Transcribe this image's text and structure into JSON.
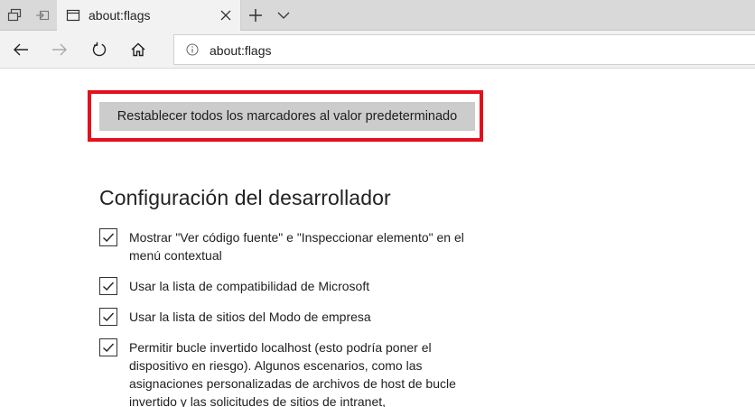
{
  "browser": {
    "tab": {
      "title": "about:flags"
    },
    "address_bar": {
      "url": "about:flags"
    },
    "icons": {
      "tab_list": "tabs-icon",
      "set_aside": "set-aside-tabs-icon",
      "favicon": "page-icon",
      "close": "close-icon",
      "new_tab": "plus-icon",
      "tab_menu": "chevron-down-icon",
      "back": "back-arrow-icon",
      "forward": "forward-arrow-icon",
      "refresh": "refresh-icon",
      "home": "home-icon",
      "info": "info-icon"
    }
  },
  "page": {
    "reset_button_label": "Restablecer todos los marcadores al valor predeterminado",
    "highlight_color": "#e3101e",
    "section_title": "Configuración del desarrollador",
    "options": [
      {
        "label": "Mostrar \"Ver código fuente\" e \"Inspeccionar elemento\" en el menú contextual",
        "checked": true
      },
      {
        "label": "Usar la lista de compatibilidad de Microsoft",
        "checked": true
      },
      {
        "label": "Usar la lista de sitios del Modo de empresa",
        "checked": true
      },
      {
        "label": "Permitir bucle invertido localhost (esto podría poner el dispositivo en riesgo). Algunos escenarios, como las asignaciones personalizadas de archivos de host de bucle invertido y las solicitudes de sitios de intranet,",
        "checked": true
      }
    ]
  }
}
